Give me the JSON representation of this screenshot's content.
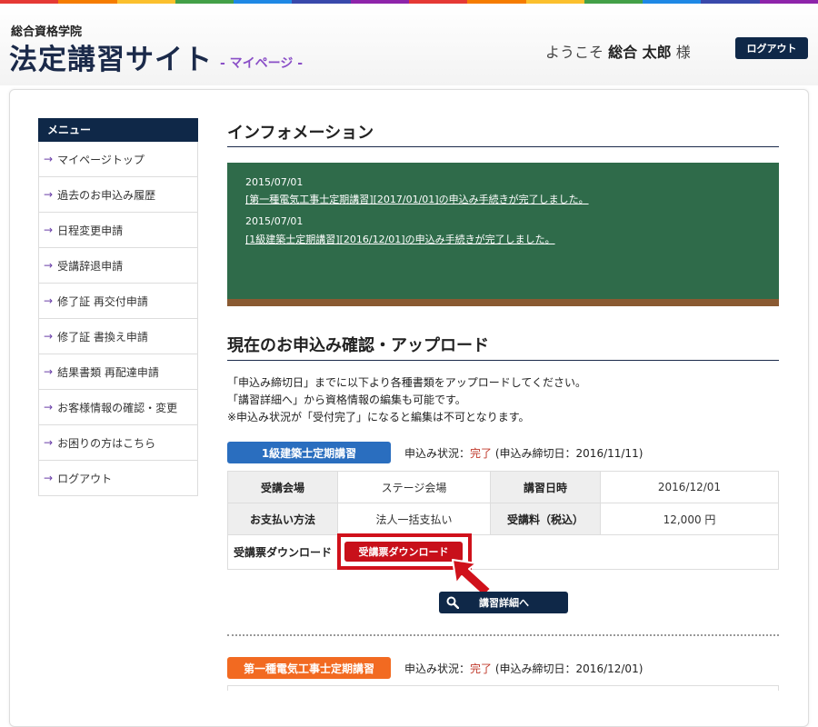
{
  "header": {
    "org_name": "総合資格学院",
    "site_title": "法定講習サイト",
    "site_subtitle": "- マイページ -",
    "welcome_prefix": "ようこそ",
    "user_name": "総合 太郎",
    "welcome_suffix": "様",
    "logout_label": "ログアウト",
    "stripe_colors": [
      "#e53935",
      "#f57c00",
      "#fbc02d",
      "#43a047",
      "#1e88e5",
      "#3949ab",
      "#8e24aa",
      "#e53935",
      "#f57c00",
      "#fbc02d",
      "#43a047",
      "#1e88e5",
      "#3949ab",
      "#8e24aa"
    ]
  },
  "sidebar": {
    "heading": "メニュー",
    "items": [
      {
        "label": "マイページトップ"
      },
      {
        "label": "過去のお申込み履歴"
      },
      {
        "label": "日程変更申請"
      },
      {
        "label": "受講辞退申請"
      },
      {
        "label": "修了証 再交付申請"
      },
      {
        "label": "修了証 書換え申請"
      },
      {
        "label": "結果書類 再配達申請"
      },
      {
        "label": "お客様情報の確認・変更"
      },
      {
        "label": "お困りの方はこちら"
      },
      {
        "label": "ログアウト"
      }
    ]
  },
  "information": {
    "title": "インフォメーション",
    "entries": [
      {
        "date": "2015/07/01",
        "text": "[第一種電気工事士定期講習][2017/01/01]の申込み手続きが完了しました。"
      },
      {
        "date": "2015/07/01",
        "text": "[1級建築士定期講習][2016/12/01]の申込み手続きが完了しました。"
      }
    ]
  },
  "applications": {
    "title": "現在のお申込み確認・アップロード",
    "description": [
      "「申込み締切日」までに以下より各種書類をアップロードしてください。",
      "「講習詳細へ」から資格情報の編集も可能です。",
      "※申込み状況が「受付完了」になると編集は不可となります。"
    ],
    "courses": [
      {
        "name": "1級建築士定期講習",
        "color": "#2a6ebf",
        "status_prefix": "申込み状況：",
        "status": "完了",
        "deadline": "(申込み締切日：2016/11/11)",
        "venue_label": "受講会場",
        "venue": "ステージ会場",
        "date_label": "講習日時",
        "date": "2016/12/01",
        "payment_label": "お支払い方法",
        "payment": "法人一括支払い",
        "fee_label": "受講料（税込）",
        "fee": "12,000 円",
        "download_label": "受講票ダウンロード",
        "download_button": "受講票ダウンロード",
        "detail_button": "講習詳細へ"
      },
      {
        "name": "第一種電気工事士定期講習",
        "color": "#f26a21",
        "status_prefix": "申込み状況：",
        "status": "完了",
        "deadline": "(申込み締切日：2016/12/01)"
      }
    ]
  }
}
